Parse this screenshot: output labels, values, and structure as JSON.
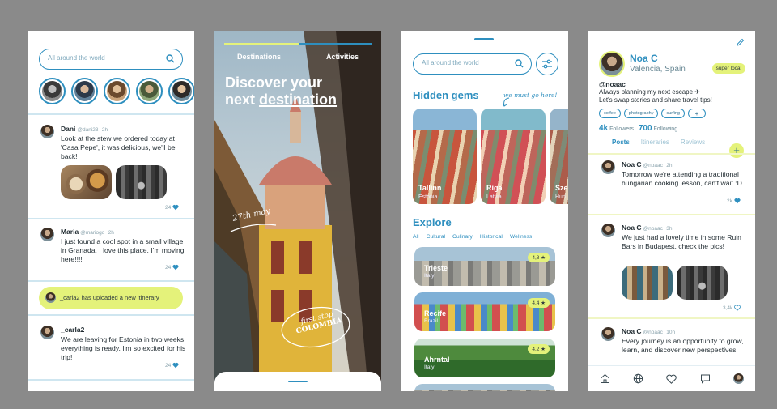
{
  "colors": {
    "accent": "#2e8fbf",
    "highlight": "#e4f27a"
  },
  "feed": {
    "search_placeholder": "All around the world",
    "stories": [
      "story-1",
      "story-2",
      "story-3",
      "story-4",
      "story-5"
    ],
    "posts": [
      {
        "name": "Dani",
        "handle": "@dani23",
        "time": "2h",
        "text": "Look at the stew we ordered today at 'Casa Pepe', it was delicious, we'll be back!",
        "likes": "24"
      },
      {
        "name": "Maria",
        "handle": "@mariogo",
        "time": "2h",
        "text": "I just found a cool spot in a small village in Granada, I love this place, I'm moving here!!!!",
        "likes": "24"
      },
      {
        "name": "_carla2",
        "handle": "",
        "time": "",
        "text": "We are leaving for Estonia in two weeks, everything is ready, I'm so excited for his trip!",
        "likes": "24"
      }
    ],
    "notification": "_carla2 has uploaded a new itinerary"
  },
  "onboarding": {
    "tabs": [
      "Destinations",
      "Activities"
    ],
    "title_line1": "Discover your",
    "title_line2_prefix": "next ",
    "title_line2_underlined": "destination",
    "date_note": "27th may",
    "stop_note_line1": "first stop",
    "stop_note_line2": "COLOMBIA"
  },
  "discover": {
    "search_placeholder": "All around the world",
    "hidden_gems_title": "Hidden gems",
    "hidden_gems_note": "we must go here!",
    "gems": [
      {
        "city": "Tallinn",
        "country": "Estonia"
      },
      {
        "city": "Riga",
        "country": "Latvia"
      },
      {
        "city": "Sze",
        "country": "Hun"
      }
    ],
    "explore_title": "Explore",
    "filters": [
      "All",
      "Cultural",
      "Culinary",
      "Historical",
      "Wellness"
    ],
    "places": [
      {
        "city": "Trieste",
        "country": "Italy",
        "rating": "4,8 ★"
      },
      {
        "city": "Recife",
        "country": "Brazil",
        "rating": "4,4 ★"
      },
      {
        "city": "Ahrntal",
        "country": "Italy",
        "rating": "4,2 ★"
      }
    ]
  },
  "profile": {
    "name": "Noa C",
    "location": "Valencia, Spain",
    "badge": "super local",
    "handle": "@noaac",
    "bio_line1": "Always planning my next escape ✈",
    "bio_line2": "Let's swap stories and share travel tips!",
    "tags": [
      "coffee",
      "photography",
      "surfing",
      "+"
    ],
    "followers_count": "4k",
    "followers_label": "Followers",
    "following_count": "700",
    "following_label": "Following",
    "tabs": [
      "Posts",
      "Itineraries",
      "Reviews"
    ],
    "add_label": "+",
    "posts": [
      {
        "name": "Noa C",
        "handle": "@noaac",
        "time": "2h",
        "text": "Tomorrow we're attending a traditional hungarian cooking lesson, can't wait :D",
        "likes": "2k"
      },
      {
        "name": "Noa C",
        "handle": "@noaac",
        "time": "3h",
        "text": "We just had a lovely time in some Ruin Bars in Budapest, check the pics!",
        "likes": "3,4k"
      },
      {
        "name": "Noa C",
        "handle": "@noaac",
        "time": "10h",
        "text": "Every journey is an opportunity to grow, learn, and discover new perspectives",
        "likes": ""
      }
    ],
    "nav_icons": [
      "home-icon",
      "globe-icon",
      "heart-icon",
      "chat-icon",
      "profile-avatar"
    ]
  }
}
